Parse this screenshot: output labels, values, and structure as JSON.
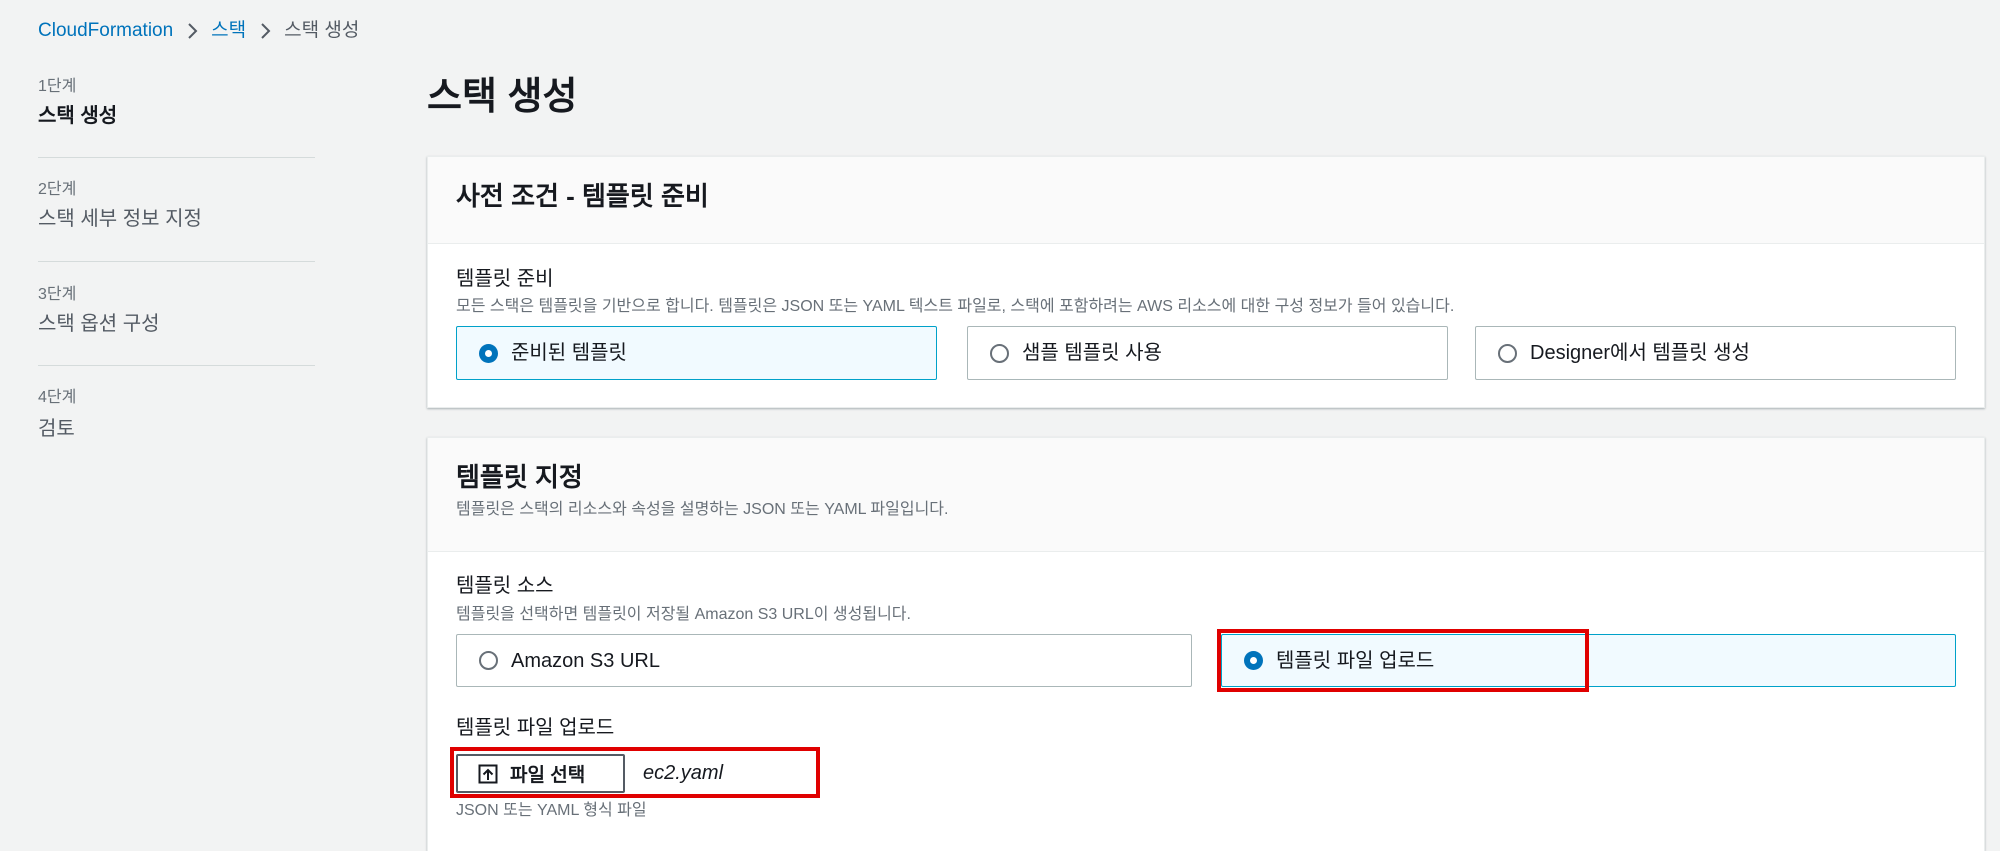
{
  "breadcrumb": {
    "root": "CloudFormation",
    "parent": "스택",
    "current": "스택 생성"
  },
  "steps": [
    {
      "step": "1단계",
      "title": "스택 생성",
      "active": true
    },
    {
      "step": "2단계",
      "title": "스택 세부 정보 지정",
      "active": false
    },
    {
      "step": "3단계",
      "title": "스택 옵션 구성",
      "active": false
    },
    {
      "step": "4단계",
      "title": "검토",
      "active": false
    }
  ],
  "page_title": "스택 생성",
  "prerequisite": {
    "title": "사전 조건 - 템플릿 준비",
    "field_label": "템플릿 준비",
    "field_description": "모든 스택은 템플릿을 기반으로 합니다. 템플릿은 JSON 또는 YAML 텍스트 파일로, 스택에 포함하려는 AWS 리소스에 대한 구성 정보가 들어 있습니다.",
    "options": [
      {
        "label": "준비된 템플릿",
        "selected": true
      },
      {
        "label": "샘플 템플릿 사용",
        "selected": false
      },
      {
        "label": "Designer에서 템플릿 생성",
        "selected": false
      }
    ]
  },
  "specify_template": {
    "title": "템플릿 지정",
    "description": "템플릿은 스택의 리소스와 속성을 설명하는 JSON 또는 YAML 파일입니다.",
    "source_label": "템플릿 소스",
    "source_description": "템플릿을 선택하면 템플릿이 저장될 Amazon S3 URL이 생성됩니다.",
    "source_options": [
      {
        "label": "Amazon S3 URL",
        "selected": false
      },
      {
        "label": "템플릿 파일 업로드",
        "selected": true
      }
    ],
    "upload_label": "템플릿 파일 업로드",
    "choose_file_button": "파일 선택",
    "chosen_file": "ec2.yaml",
    "file_hint": "JSON 또는 YAML 형식 파일"
  },
  "icons": {
    "breadcrumb_separator": "chevron-right-icon",
    "radio": "radio-icon",
    "upload": "upload-icon"
  },
  "colors": {
    "background": "#f2f3f3",
    "link": "#0073bb",
    "selected_tile_background": "#f1faff",
    "selected_tile_border": "#00a1c9",
    "radio_selected": "#0073bb",
    "highlight": "#e00000"
  }
}
